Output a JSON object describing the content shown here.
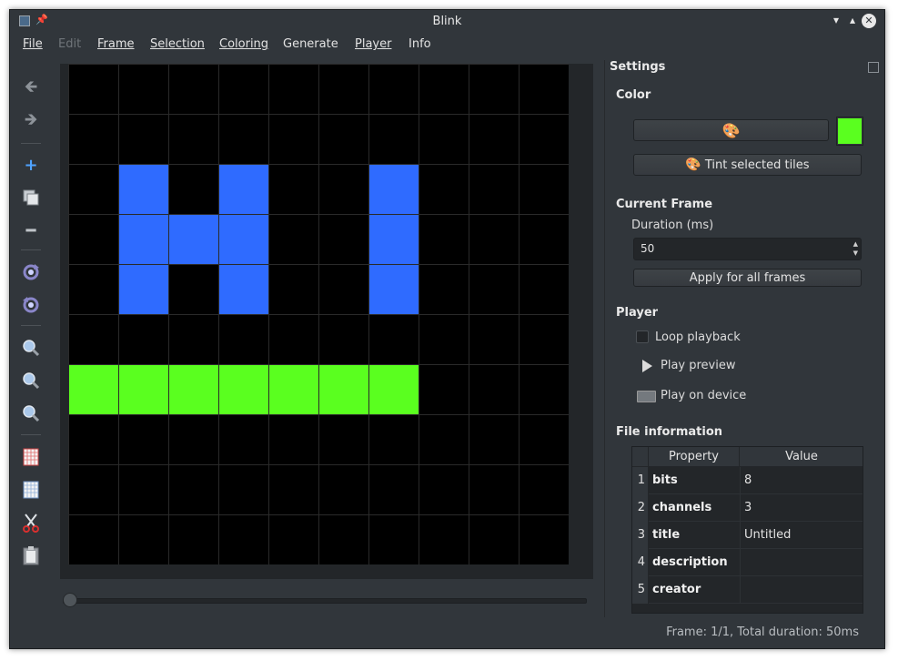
{
  "window": {
    "title": "Blink"
  },
  "menu": {
    "file": "File",
    "edit": "Edit",
    "frame": "Frame",
    "selection": "Selection",
    "coloring": "Coloring",
    "generate": "Generate",
    "player": "Player",
    "info": "Info"
  },
  "colors": {
    "blue": "#2f6bff",
    "green": "#5aff1f",
    "off": "#000000"
  },
  "grid": {
    "rows": 10,
    "cols": 10,
    "cells": [
      "..........",
      "..........",
      ".B.B..B...",
      ".BBB..B...",
      ".B.B..B...",
      "..........",
      "GGGGGGG...",
      "..........",
      "..........",
      ".........."
    ]
  },
  "toolbar": {
    "icons": [
      "back-arrow-icon",
      "forward-arrow-icon",
      "add-icon",
      "duplicate-icon",
      "remove-icon",
      "rotate-cw-icon",
      "rotate-ccw-icon",
      "zoom-in-icon",
      "zoom-out-icon",
      "zoom-fit-icon",
      "show-grid-icon",
      "hide-grid-icon",
      "cut-icon",
      "paste-icon"
    ]
  },
  "settings": {
    "title": "Settings",
    "color_section": "Color",
    "current_color": "#5aff1f",
    "tint_label": "Tint selected tiles",
    "frame_section": "Current Frame",
    "duration_label": "Duration (ms)",
    "duration_value": "50",
    "apply_all_label": "Apply for all frames",
    "player_section": "Player",
    "loop_label": "Loop playback",
    "play_preview_label": "Play preview",
    "play_device_label": "Play on device",
    "fileinfo_section": "File information",
    "table": {
      "headers": [
        "Property",
        "Value"
      ],
      "rows": [
        {
          "n": "1",
          "key": "bits",
          "value": "8"
        },
        {
          "n": "2",
          "key": "channels",
          "value": "3"
        },
        {
          "n": "3",
          "key": "title",
          "value": "Untitled"
        },
        {
          "n": "4",
          "key": "description",
          "value": ""
        },
        {
          "n": "5",
          "key": "creator",
          "value": ""
        }
      ]
    }
  },
  "status": {
    "text": "Frame: 1/1, Total duration: 50ms"
  }
}
